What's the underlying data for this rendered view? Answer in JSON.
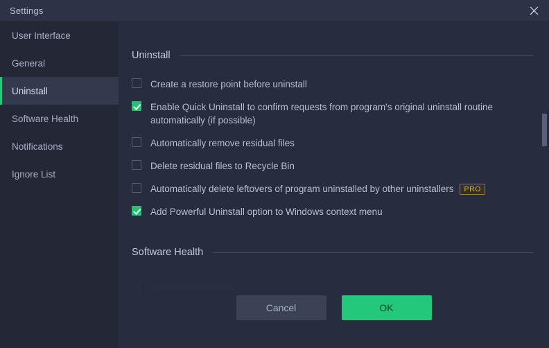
{
  "window": {
    "title": "Settings",
    "close_icon": "close-icon"
  },
  "colors": {
    "accent_green": "#22c97a",
    "sidebar_bg": "#242836",
    "content_bg": "#272c3f",
    "titlebar_bg": "#2d3346",
    "pro_badge": "#e0b341"
  },
  "sidebar": {
    "items": [
      {
        "label": "User Interface",
        "active": false
      },
      {
        "label": "General",
        "active": false
      },
      {
        "label": "Uninstall",
        "active": true
      },
      {
        "label": "Software Health",
        "active": false
      },
      {
        "label": "Notifications",
        "active": false
      },
      {
        "label": "Ignore List",
        "active": false
      }
    ]
  },
  "sections": [
    {
      "title": "Uninstall",
      "options": [
        {
          "label": "Create a restore point before uninstall",
          "checked": false,
          "pro": false
        },
        {
          "label": "Enable Quick Uninstall to confirm requests from program's original uninstall routine automatically (if possible)",
          "checked": true,
          "pro": false
        },
        {
          "label": "Automatically remove residual files",
          "checked": false,
          "pro": false
        },
        {
          "label": "Delete residual files to Recycle Bin",
          "checked": false,
          "pro": false
        },
        {
          "label": "Automatically delete leftovers of program uninstalled by other uninstallers",
          "checked": false,
          "pro": true,
          "pro_label": "PRO"
        },
        {
          "label": "Add Powerful Uninstall option to Windows context menu",
          "checked": true,
          "pro": false
        }
      ]
    },
    {
      "title": "Software Health",
      "options": []
    }
  ],
  "footer": {
    "cancel_label": "Cancel",
    "ok_label": "OK"
  }
}
